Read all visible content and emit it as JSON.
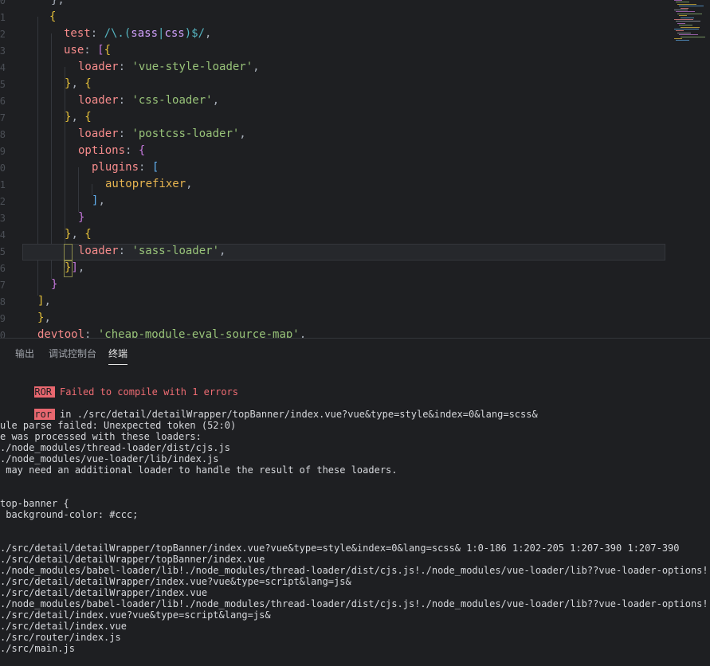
{
  "editor": {
    "gutter_numbers": [
      "0",
      "1",
      "2",
      "3",
      "4",
      "5",
      "6",
      "7",
      "8",
      "9",
      "0",
      "1",
      "2",
      "3",
      "4",
      "5",
      "6",
      "7",
      "8",
      "9",
      "0"
    ],
    "lines": [
      {
        "parts": [
          [
            "pun",
            "},"
          ]
        ]
      },
      {
        "parts": [
          [
            "brace-y",
            "{"
          ]
        ]
      },
      {
        "parts": [
          [
            "prop",
            "test"
          ],
          [
            "pun",
            ": "
          ],
          [
            "reg",
            "/\\.("
          ],
          [
            "regx",
            "sass"
          ],
          [
            "reg",
            "|"
          ],
          [
            "regx",
            "css"
          ],
          [
            "reg",
            ")$/"
          ],
          [
            "pun",
            ","
          ]
        ]
      },
      {
        "parts": [
          [
            "prop",
            "use"
          ],
          [
            "pun",
            ": "
          ],
          [
            "brace-p",
            "["
          ],
          [
            "brace-y",
            "{"
          ]
        ]
      },
      {
        "parts": [
          [
            "prop",
            "loader"
          ],
          [
            "pun",
            ": "
          ],
          [
            "str",
            "'vue-style-loader'"
          ],
          [
            "pun",
            ","
          ]
        ]
      },
      {
        "parts": [
          [
            "brace-y",
            "}"
          ],
          [
            "pun",
            ", "
          ],
          [
            "brace-y",
            "{"
          ]
        ]
      },
      {
        "parts": [
          [
            "prop",
            "loader"
          ],
          [
            "pun",
            ": "
          ],
          [
            "str",
            "'css-loader'"
          ],
          [
            "pun",
            ","
          ]
        ]
      },
      {
        "parts": [
          [
            "brace-y",
            "}"
          ],
          [
            "pun",
            ", "
          ],
          [
            "brace-y",
            "{"
          ]
        ]
      },
      {
        "parts": [
          [
            "prop",
            "loader"
          ],
          [
            "pun",
            ": "
          ],
          [
            "str",
            "'postcss-loader'"
          ],
          [
            "pun",
            ","
          ]
        ]
      },
      {
        "parts": [
          [
            "prop",
            "options"
          ],
          [
            "pun",
            ": "
          ],
          [
            "brace-p",
            "{"
          ]
        ]
      },
      {
        "parts": [
          [
            "prop",
            "plugins"
          ],
          [
            "pun",
            ": "
          ],
          [
            "brace-b",
            "["
          ]
        ]
      },
      {
        "parts": [
          [
            "ident",
            "autoprefixer"
          ],
          [
            "pun",
            ","
          ]
        ]
      },
      {
        "parts": [
          [
            "brace-b",
            "]"
          ],
          [
            "pun",
            ","
          ]
        ]
      },
      {
        "parts": [
          [
            "brace-p",
            "}"
          ]
        ]
      },
      {
        "parts": [
          [
            "brace-y",
            "}"
          ],
          [
            "pun",
            ", "
          ],
          [
            "brace-y",
            "{"
          ]
        ]
      },
      {
        "parts": [
          [
            "prop",
            "loader"
          ],
          [
            "pun",
            ": "
          ],
          [
            "str",
            "'sass-loader'"
          ],
          [
            "pun",
            ","
          ]
        ]
      },
      {
        "parts": [
          [
            "brace-y",
            "}"
          ],
          [
            "brace-p",
            "]"
          ],
          [
            "pun",
            ","
          ]
        ]
      },
      {
        "parts": [
          [
            "brace-p",
            "}"
          ]
        ]
      },
      {
        "parts": [
          [
            "brace-y",
            "]"
          ],
          [
            "pun",
            ","
          ]
        ]
      },
      {
        "parts": [
          [
            "brace-y",
            "}"
          ],
          [
            "pun",
            ","
          ]
        ]
      },
      {
        "parts": [
          [
            "prop",
            "devtool"
          ],
          [
            "pun",
            ": "
          ],
          [
            "str",
            "'cheap-module-eval-source-map'"
          ],
          [
            "pun",
            ","
          ]
        ]
      }
    ]
  },
  "panel": {
    "tabs": [
      {
        "label": "输出",
        "active": false
      },
      {
        "label": "调试控制台",
        "active": false
      },
      {
        "label": "终端",
        "active": true
      }
    ]
  },
  "terminal": {
    "error_badge": "ROR",
    "error_title": "Failed to compile with 1 errors",
    "error_badge_2": "ror",
    "error_location": "in ./src/detail/detailWrapper/topBanner/index.vue?vue&type=style&index=0&lang=scss&",
    "lines": [
      "ule parse failed: Unexpected token (52:0)",
      "e was processed with these loaders:",
      "./node_modules/thread-loader/dist/cjs.js",
      "./node_modules/vue-loader/lib/index.js",
      " may need an additional loader to handle the result of these loaders.",
      "",
      "",
      "top-banner {",
      " background-color: #ccc;",
      "",
      "",
      "./src/detail/detailWrapper/topBanner/index.vue?vue&type=style&index=0&lang=scss& 1:0-186 1:202-205 1:207-390 1:207-390",
      "./src/detail/detailWrapper/topBanner/index.vue",
      "./node_modules/babel-loader/lib!./node_modules/thread-loader/dist/cjs.js!./node_modules/vue-loader/lib??vue-loader-options!.",
      "./src/detail/detailWrapper/index.vue?vue&type=script&lang=js&",
      "./src/detail/detailWrapper/index.vue",
      "./node_modules/babel-loader/lib!./node_modules/thread-loader/dist/cjs.js!./node_modules/vue-loader/lib??vue-loader-options!.",
      "./src/detail/index.vue?vue&type=script&lang=js&",
      "./src/detail/index.vue",
      "./src/router/index.js",
      "./src/main.js"
    ]
  }
}
